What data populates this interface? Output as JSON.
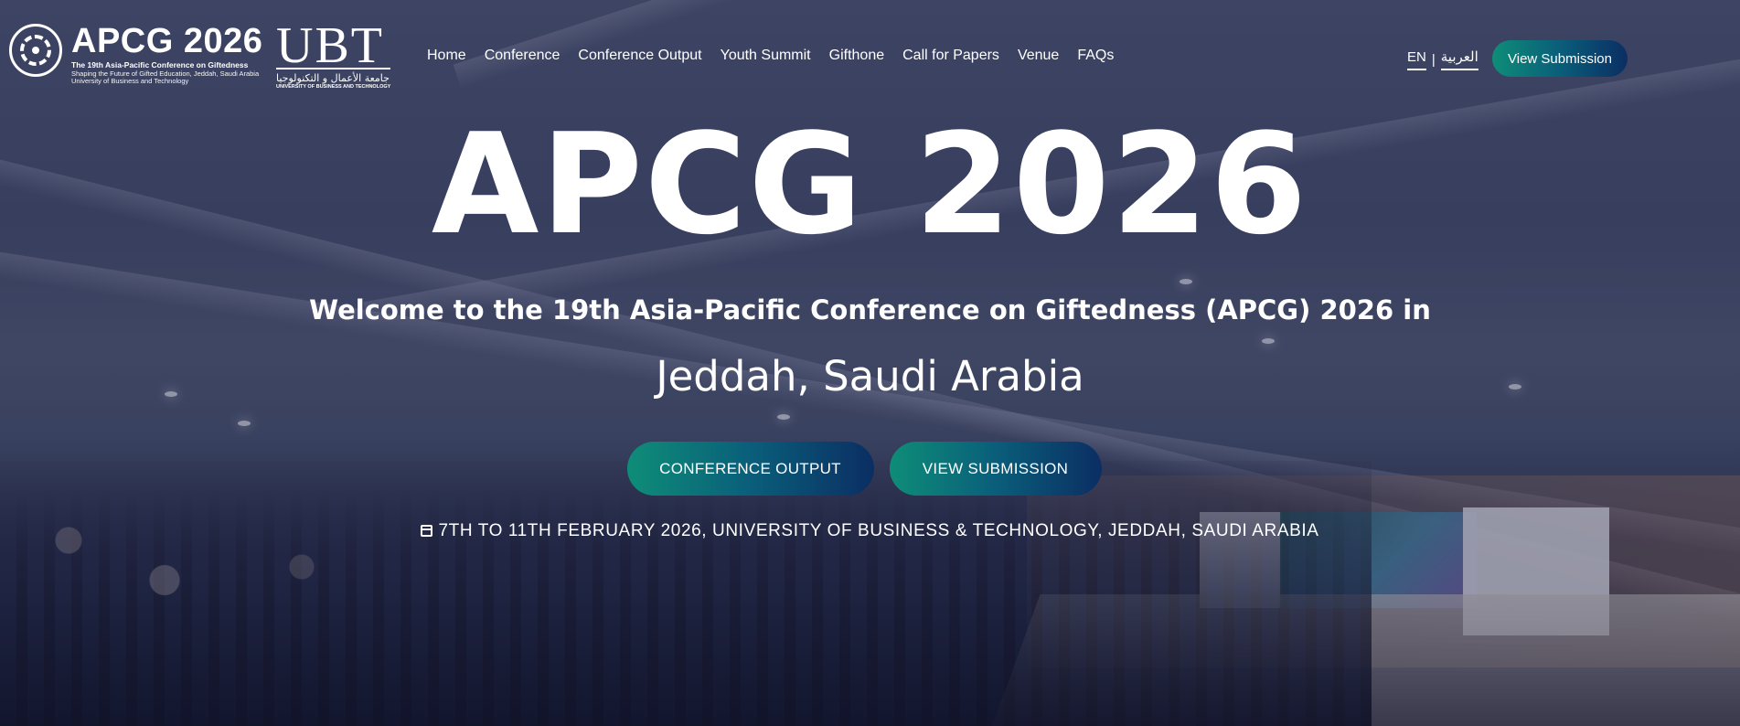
{
  "header": {
    "logo": {
      "title": "APCG 2026",
      "line1": "The 19th Asia-Pacific Conference on Giftedness",
      "line2": "Shaping the Future of Gifted Education, Jeddah, Saudi Arabia",
      "line3": "University of Business and Technology"
    },
    "ubt_logo": {
      "text": "UBT",
      "arabic": "جامعة الأعمال و التكنولوجيا",
      "english": "UNIVERSITY OF BUSINESS AND TECHNOLOGY"
    },
    "nav": [
      "Home",
      "Conference",
      "Conference Output",
      "Youth Summit",
      "Gifthone",
      "Call for Papers",
      "Venue",
      "FAQs"
    ],
    "lang": {
      "en": "EN",
      "separator": "|",
      "ar": "العربية"
    },
    "cta": "View Submission"
  },
  "hero": {
    "title": "APCG 2026",
    "welcome": "Welcome to the 19th Asia-Pacific Conference on Giftedness (APCG) 2026 in",
    "city": "Jeddah, Saudi Arabia",
    "buttons": {
      "primary": "CONFERENCE OUTPUT",
      "secondary": "VIEW SUBMISSION"
    },
    "date_icon": "calendar-icon",
    "date": "7TH TO 11TH FEBRUARY 2026, UNIVERSITY OF BUSINESS & TECHNOLOGY, JEDDAH, SAUDI ARABIA"
  },
  "colors": {
    "button_gradient_start": "#0e8d78",
    "button_gradient_end": "#0b2e63",
    "overlay": "#1e2446"
  }
}
